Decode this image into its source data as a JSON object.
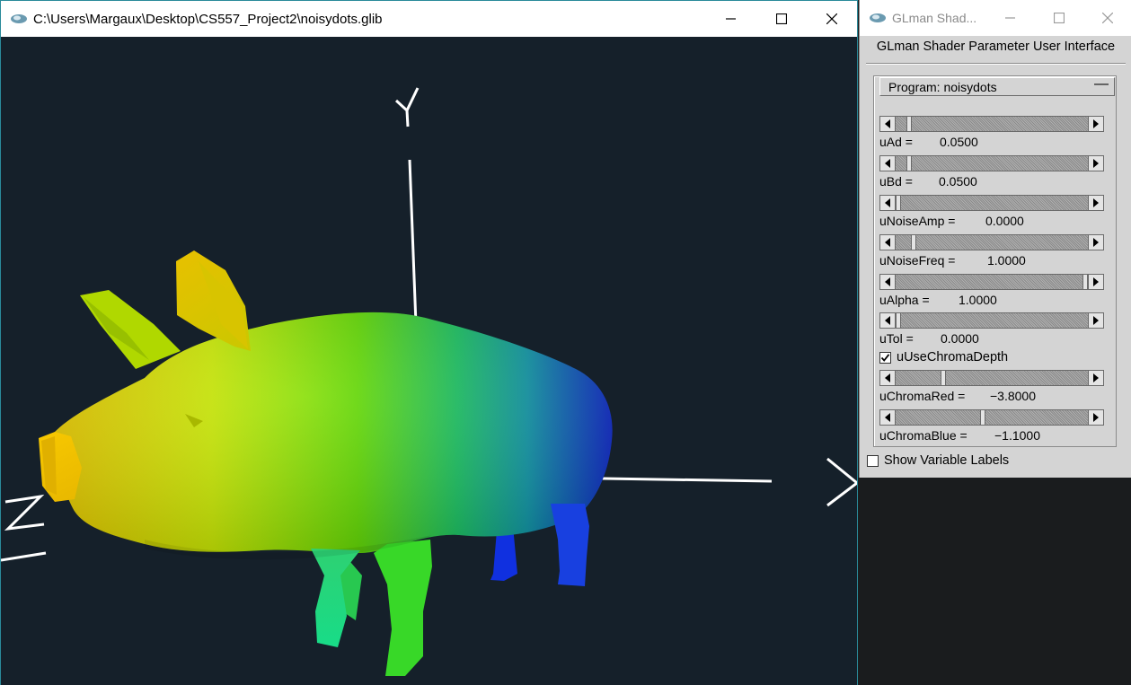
{
  "main_window": {
    "title": "C:\\Users\\Margaux\\Desktop\\CS557_Project2\\noisydots.glib",
    "axes": {
      "y_label": "Y",
      "x_label": "X",
      "z_label": "Z"
    }
  },
  "glman_window": {
    "title": "GLman Shad...",
    "heading": "GLman Shader Parameter User Interface",
    "program_label": "Program: noisydots",
    "collapse_symbol": "—",
    "params": [
      {
        "name": "uAd =",
        "value": "0.0500",
        "fraction": 0.06
      },
      {
        "name": "uBd =",
        "value": "0.0500",
        "fraction": 0.06
      },
      {
        "name": "uNoiseAmp =",
        "value": "0.0000",
        "fraction": 0.0
      },
      {
        "name": "uNoiseFreq =",
        "value": "1.0000",
        "fraction": 0.08
      },
      {
        "name": "uAlpha =",
        "value": "1.0000",
        "fraction": 1.0
      },
      {
        "name": "uTol =",
        "value": "0.0000",
        "fraction": 0.0
      },
      {
        "name": "uChromaRed =",
        "value": "−3.8000",
        "fraction": 0.24
      },
      {
        "name": "uChromaBlue =",
        "value": "−1.1000",
        "fraction": 0.45
      }
    ],
    "use_chroma_depth": {
      "label": "uUseChromaDepth",
      "checked": true
    },
    "show_variable_labels": {
      "label": "Show Variable Labels",
      "checked": false
    }
  },
  "colors": {
    "viewport_bg": "#15202a",
    "panel_bg": "#d4d4d4",
    "axis": "#ffffff"
  }
}
